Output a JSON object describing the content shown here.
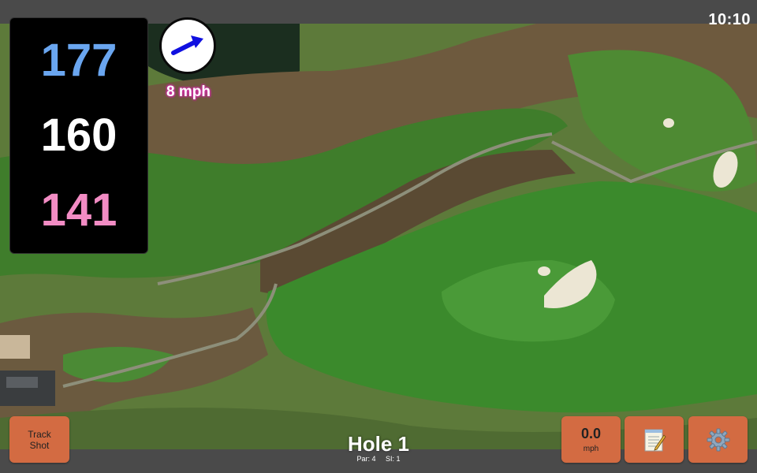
{
  "status": {
    "time": "10:10"
  },
  "distances": {
    "back": "177",
    "middle": "160",
    "front": "141"
  },
  "wind": {
    "speed": "8 mph",
    "icon": "wind-arrow-icon",
    "color": "#1010e0"
  },
  "hole": {
    "title": "Hole 1",
    "par": "Par: 4",
    "stroke_index": "SI: 1"
  },
  "buttons": {
    "track_shot_line1": "Track",
    "track_shot_line2": "Shot",
    "speed_value": "0.0",
    "speed_unit": "mph",
    "notes_icon": "notepad-icon",
    "settings_icon": "gear-icon"
  },
  "colors": {
    "button_bg": "#d36b42",
    "distance_back": "#6aa6f0",
    "distance_middle": "#ffffff",
    "distance_front": "#f28cc4",
    "bar_bg": "#4a4a4a"
  }
}
